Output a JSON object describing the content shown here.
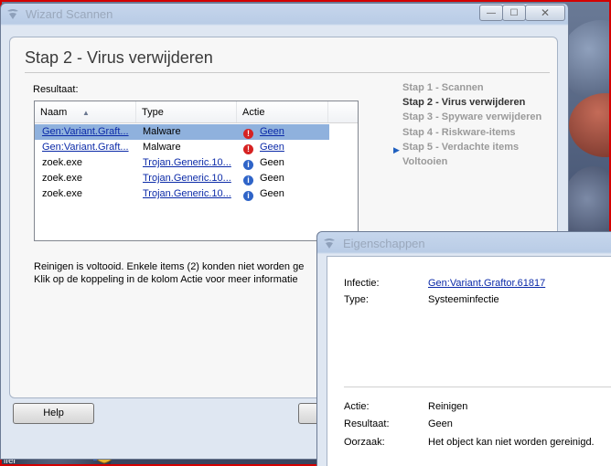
{
  "wizard": {
    "title": "Wizard Scannen",
    "close_glyph": "✕",
    "minimize_glyph": "—",
    "maximize_glyph": "☐",
    "heading": "Stap 2 - Virus verwijderen",
    "result_label": "Resultaat:",
    "columns": [
      "Naam",
      "Type",
      "Actie"
    ],
    "rows": [
      {
        "name": "Gen:Variant.Graft...",
        "type": "Malware",
        "action": "Geen",
        "status_icon": "error-icon",
        "selected": true
      },
      {
        "name": "Gen:Variant.Graft...",
        "type": "Malware",
        "action": "Geen",
        "status_icon": "error-icon",
        "selected": false
      },
      {
        "name": "zoek.exe",
        "type": "Trojan.Generic.10...",
        "action": "Geen",
        "status_icon": "info-icon",
        "selected": false
      },
      {
        "name": "zoek.exe",
        "type": "Trojan.Generic.10...",
        "action": "Geen",
        "status_icon": "info-icon",
        "selected": false
      },
      {
        "name": "zoek.exe",
        "type": "Trojan.Generic.10...",
        "action": "Geen",
        "status_icon": "info-icon",
        "selected": false
      }
    ],
    "steps": [
      "Stap 1 - Scannen",
      "Stap 2 - Virus verwijderen",
      "Stap 3 - Spyware verwijderen",
      "Stap 4 - Riskware-items",
      "Stap 5 - Verdachte items",
      "Voltooien"
    ],
    "status_line1": "Reinigen is voltooid. Enkele items (2) konden niet worden ge",
    "status_line2": "Klik op de koppeling in de kolom Actie voor meer informatie",
    "help_button": "Help"
  },
  "properties": {
    "title": "Eigenschappen",
    "infection_label": "Infectie:",
    "infection_value": "Gen:Variant.Graftor.61817",
    "type_label": "Type:",
    "type_value": "Systeeminfectie",
    "action_label": "Actie:",
    "action_value": "Reinigen",
    "result_label": "Resultaat:",
    "result_value": "Geen",
    "cause_label": "Oorzaak:",
    "cause_value": "Het object kan niet worden gereinigd."
  },
  "desktop": {
    "label": "ifer"
  },
  "colors": {
    "selection": "#8fb1dd",
    "link": "#0b2aa8",
    "error": "#d62222",
    "info": "#2f64c8"
  }
}
